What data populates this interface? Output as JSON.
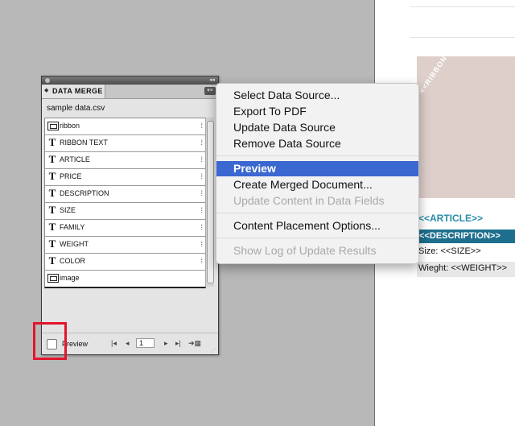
{
  "panel": {
    "title": "DATA MERGE",
    "source_file": "sample data.csv",
    "fields": [
      {
        "label": "ribbon",
        "icon": "image-field-icon"
      },
      {
        "label": "RIBBON TEXT",
        "icon": "text-field-icon"
      },
      {
        "label": "ARTICLE",
        "icon": "text-field-icon"
      },
      {
        "label": "PRICE",
        "icon": "text-field-icon"
      },
      {
        "label": "DESCRIPTION",
        "icon": "text-field-icon"
      },
      {
        "label": "SIZE",
        "icon": "text-field-icon"
      },
      {
        "label": "FAMILY",
        "icon": "text-field-icon"
      },
      {
        "label": "WEIGHT",
        "icon": "text-field-icon"
      },
      {
        "label": "COLOR",
        "icon": "text-field-icon"
      },
      {
        "label": "image",
        "icon": "image-field-icon"
      }
    ],
    "text_icon_glyph": "T",
    "preview_label": "Preview",
    "record_number": "1"
  },
  "menu": {
    "items": [
      {
        "label": "Select Data Source...",
        "enabled": true
      },
      {
        "label": "Export To PDF",
        "enabled": true
      },
      {
        "label": "Update Data Source",
        "enabled": true
      },
      {
        "label": "Remove Data Source",
        "enabled": true
      },
      {
        "label": "Preview",
        "enabled": true,
        "selected": true
      },
      {
        "label": "Create Merged Document...",
        "enabled": true
      },
      {
        "label": "Update Content in Data Fields",
        "enabled": false
      },
      {
        "label": "Content Placement Options...",
        "enabled": true
      },
      {
        "label": "Show Log of Update Results",
        "enabled": false
      }
    ]
  },
  "document": {
    "ribbon_text": "<<RIBBON",
    "article": "<<ARTICLE>>",
    "description": "<<DESCRIPTION>>",
    "size": "Size: <<SIZE>>",
    "weight": "Wieght: <<WEIGHT>>"
  },
  "colors": {
    "menu_selection": "#3b67d0",
    "highlight_box": "#e2152d",
    "article_text": "#2a8caa",
    "description_bar": "#1d6f8d",
    "image_frame": "#decfcb"
  }
}
